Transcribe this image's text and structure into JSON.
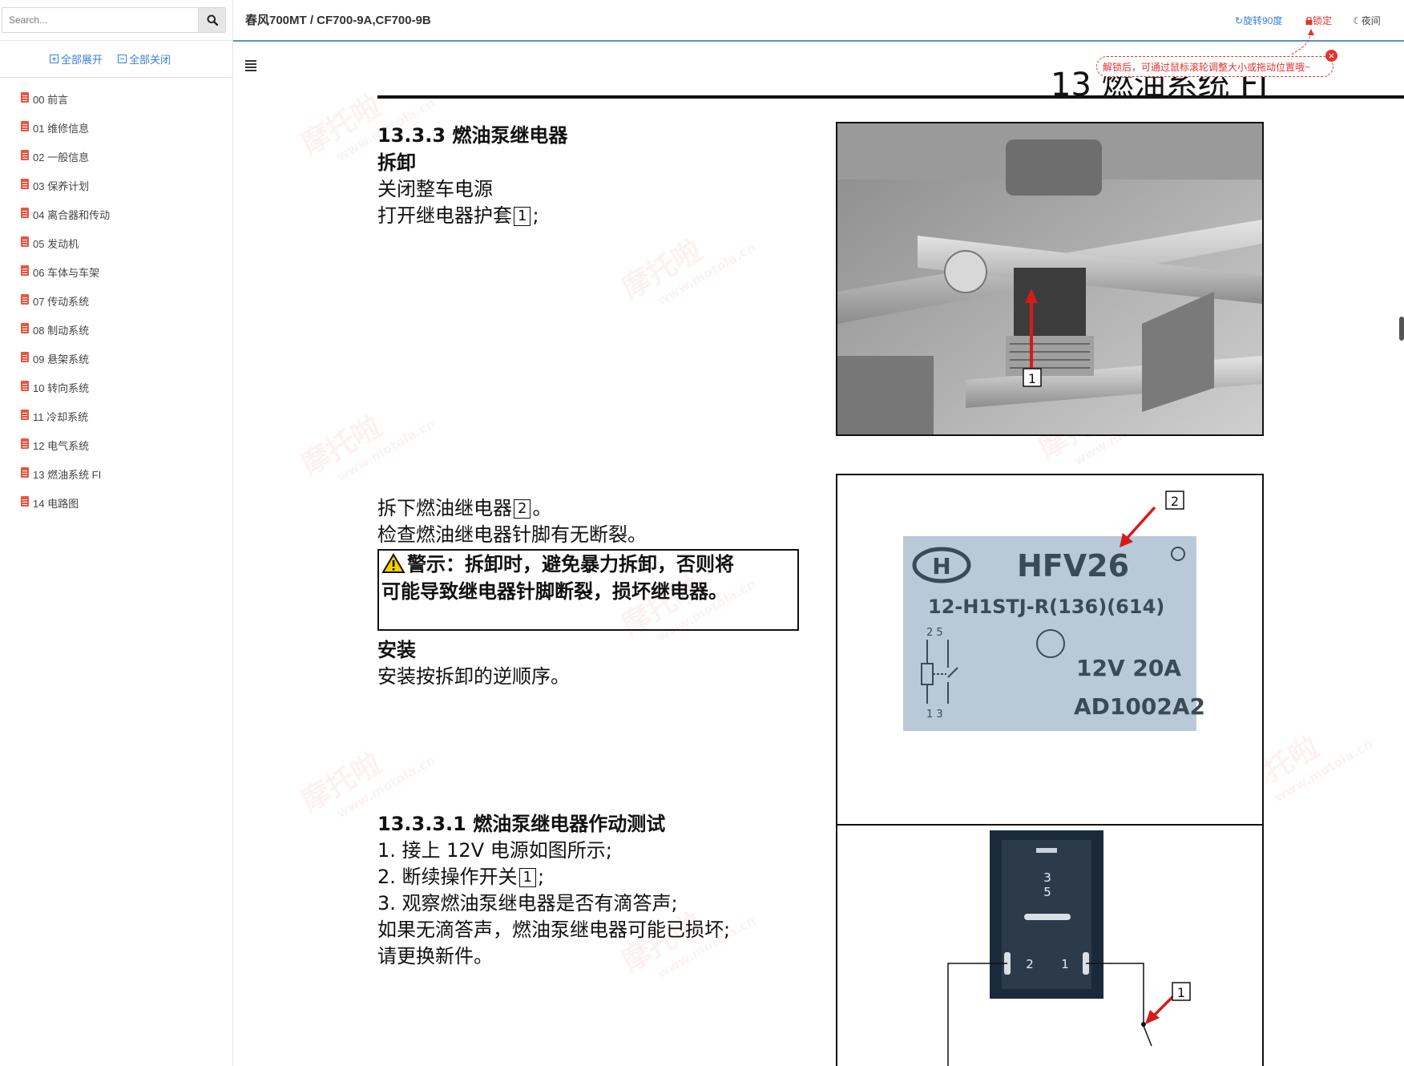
{
  "sidebar": {
    "search_placeholder": "Search...",
    "expand_all": "全部展开",
    "collapse_all": "全部关闭",
    "items": [
      "00 前言",
      "01 维修信息",
      "02 一般信息",
      "03 保养计划",
      "04 离合器和传动",
      "05 发动机",
      "06 车体与车架",
      "07 传动系统",
      "08 制动系统",
      "09 悬架系统",
      "10 转向系统",
      "11 冷却系统",
      "12 电气系统",
      "13 燃油系统 FI",
      "14 电路图"
    ]
  },
  "header": {
    "title": "春风700MT / CF700-9A,CF700-9B",
    "rotate": "旋转90度",
    "lock": "锁定",
    "night": "夜间",
    "tip": "解锁后，可通过鼠标滚轮调整大小或拖动位置哦~",
    "tip_close": "×"
  },
  "page": {
    "chapter": "13 燃油系统 FI",
    "s1_title": "13.3.3 燃油泵继电器",
    "s1_sub": "拆卸",
    "s1_l1": "关闭整车电源",
    "s1_l2a": "打开继电器护套",
    "s1_l2_num": "1",
    "s1_l2b": ";",
    "s2_l1a": "拆下燃油继电器",
    "s2_l1_num": "2",
    "s2_l1b": "。",
    "s2_l2": "检查燃油继电器针脚有无断裂。",
    "warn_l1": "警示：拆卸时，避免暴力拆卸，否则将",
    "warn_l2": "可能导致继电器针脚断裂，损坏继电器。",
    "install_title": "安装",
    "install_text": "安装按拆卸的逆顺序。",
    "s3_title": "13.3.3.1 燃油泵继电器作动测试",
    "s3_l1": "1. 接上 12V 电源如图所示;",
    "s3_l2a": "2. 断续操作开关",
    "s3_l2_num": "1",
    "s3_l2b": ";",
    "s3_l3": "3. 观察燃油泵继电器是否有滴答声;",
    "s3_l4": "如果无滴答声，燃油泵继电器可能已损坏;",
    "s3_l5": "请更换新件。",
    "fig1_callout": "1",
    "fig2_callout": "2",
    "fig2_brand": "HFV26",
    "fig2_model": "12-H1STJ-R(136)(614)",
    "fig2_rating": "12V  20A",
    "fig2_code": "AD1002A2",
    "fig2_pins_top": "2  5",
    "fig2_pins_bottom": "1  3",
    "fig3_callout": "1",
    "fig3_pin35": "3",
    "fig3_pin5": "5",
    "fig3_pin2": "2",
    "fig3_pin1": "1",
    "watermark": "摩托啦",
    "watermark_url": "www.motola.cn"
  },
  "colors": {
    "accent": "#3a7fd5",
    "lock_red": "#e3322f",
    "header_rule": "#5a8fc9",
    "doc_icon": "#e8553e"
  }
}
